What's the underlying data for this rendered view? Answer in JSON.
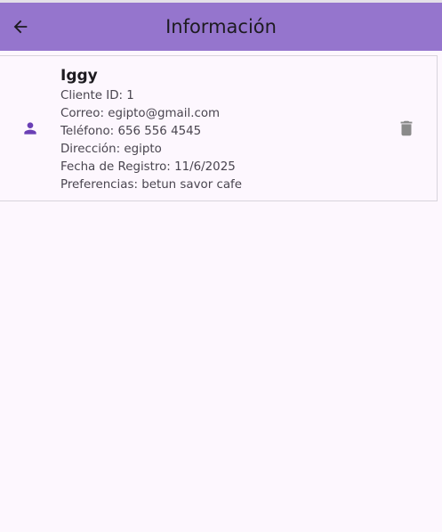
{
  "app_bar": {
    "title": "Información",
    "back_icon": "arrow-back-icon",
    "background_color": "#9575cd"
  },
  "client": {
    "name": "Iggy",
    "avatar_icon": "person-icon",
    "delete_icon": "trash-icon",
    "lines": [
      "Cliente ID: 1",
      "Correo: egipto@gmail.com",
      "Teléfono: 656 556 4545",
      "Dirección: egipto",
      "Fecha de Registro: 11/6/2025",
      "Preferencias: betun savor cafe"
    ]
  },
  "colors": {
    "accent": "#6a3fb5",
    "page_background": "#fdf7fe",
    "delete_icon": "#8a8a8a"
  }
}
